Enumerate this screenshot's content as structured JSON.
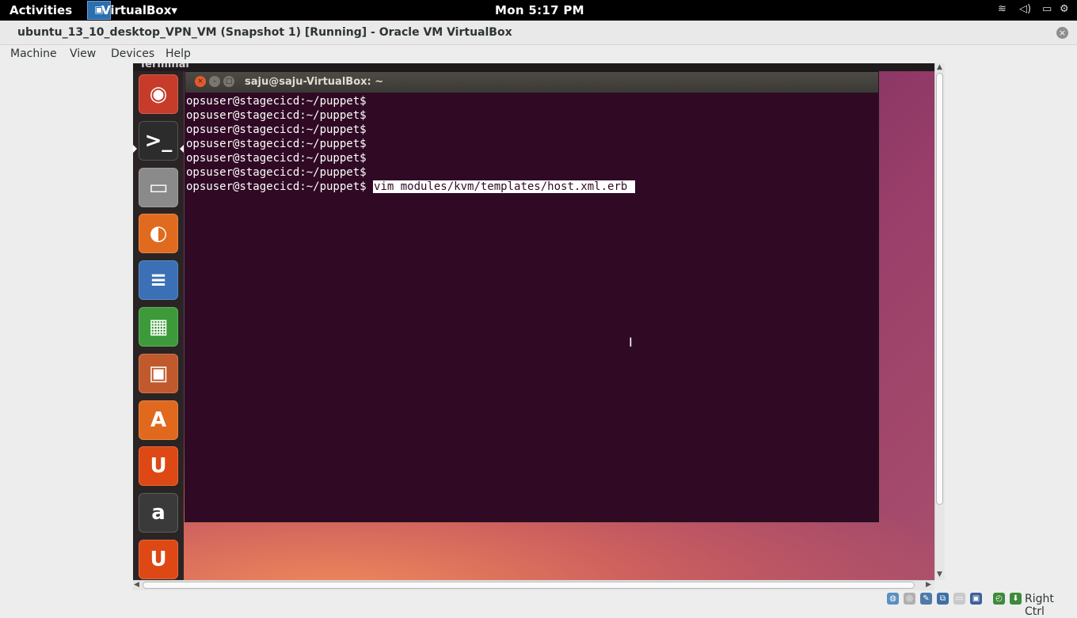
{
  "topbar": {
    "activities": "Activities",
    "app_name": "VirtualBox",
    "app_menu_arrow": "▾",
    "clock": "Mon  5:17 PM",
    "tray_icons": [
      "wifi-icon",
      "volume-icon",
      "battery-icon",
      "settings-icon"
    ]
  },
  "vbox_window": {
    "title": "ubuntu_13_10_desktop_VPN_VM (Snapshot 1) [Running] - Oracle VM VirtualBox",
    "close_glyph": "×",
    "menu": [
      "Machine",
      "View",
      "Devices",
      "Help"
    ]
  },
  "guest": {
    "panel_title": "Terminal",
    "launcher": [
      {
        "name": "ubuntu-dash",
        "glyph": "◉",
        "color": "#c63b2a"
      },
      {
        "name": "terminal",
        "glyph": ">_",
        "color": "#2c2c2c"
      },
      {
        "name": "files",
        "glyph": "▭",
        "color": "#8a8a8a"
      },
      {
        "name": "firefox",
        "glyph": "◐",
        "color": "#e06b1f"
      },
      {
        "name": "libreoffice-writer",
        "glyph": "≡",
        "color": "#3b6fb6"
      },
      {
        "name": "libreoffice-calc",
        "glyph": "▦",
        "color": "#3d9a3a"
      },
      {
        "name": "libreoffice-impress",
        "glyph": "▣",
        "color": "#c0592c"
      },
      {
        "name": "software-center",
        "glyph": "A",
        "color": "#e0691e"
      },
      {
        "name": "ubuntu-one",
        "glyph": "U",
        "color": "#dd4814"
      },
      {
        "name": "amazon",
        "glyph": "a",
        "color": "#3a3a3a"
      },
      {
        "name": "ubuntu-one-music",
        "glyph": "U",
        "color": "#dd4814"
      }
    ],
    "terminal": {
      "title": "saju@saju-VirtualBox: ~",
      "prompt": "opsuser@stagecicd:~/puppet$",
      "empty_prompt_lines": 6,
      "command": "vim modules/kvm/templates/host.xml.erb "
    }
  },
  "statusbar": {
    "icons": [
      "hard-disk-icon",
      "optical-drive-icon",
      "usb-icon",
      "network-icon",
      "shared-folders-icon",
      "display-icon",
      "capture-icon",
      "mouse-integration-icon"
    ],
    "host_key": "Right Ctrl"
  },
  "colors": {
    "terminal_bg": "#300a24",
    "close_button": "#e25a2f"
  }
}
